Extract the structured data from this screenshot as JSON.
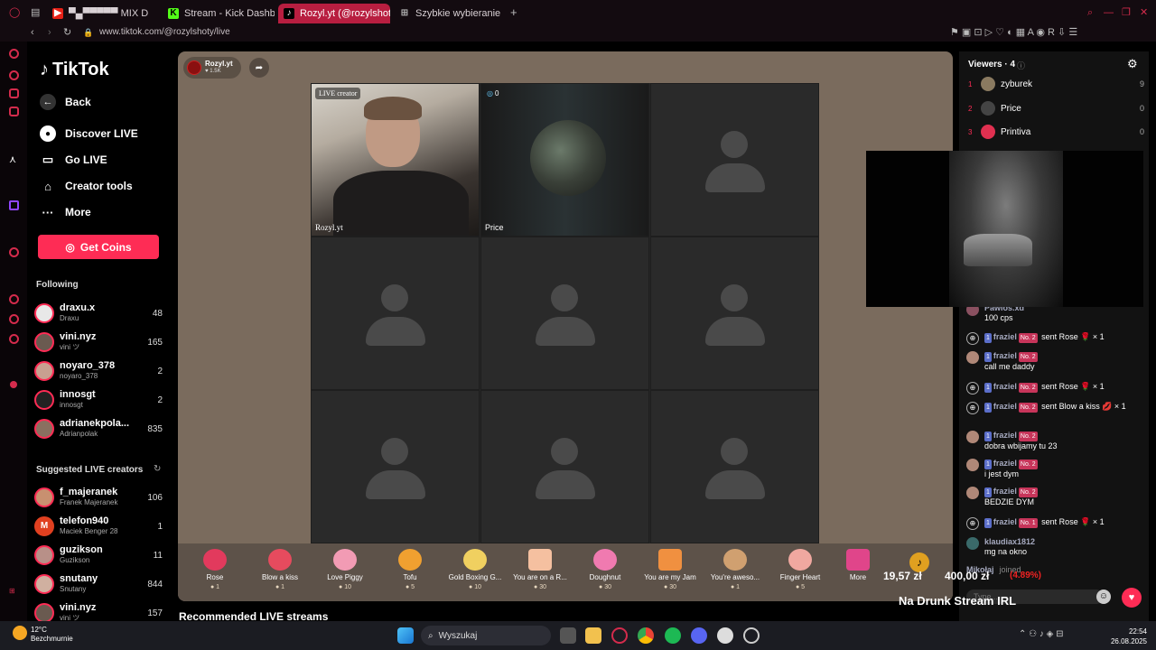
{
  "browser": {
    "tabs": [
      {
        "title": "▀▄▀▀▀▀▀ MIX D",
        "icon": "youtube-icon"
      },
      {
        "title": "Stream - Kick Dashboard",
        "icon": "kick-icon"
      },
      {
        "title": "Rozyl.yt (@rozylshoty",
        "icon": "tiktok-icon"
      },
      {
        "title": "Szybkie wybieranie",
        "icon": "speed-dial-icon"
      }
    ],
    "url": "www.tiktok.com/@rozylshoty/live"
  },
  "tiktok": {
    "logo": "TikTok",
    "nav": {
      "back": "Back",
      "discover": "Discover LIVE",
      "go_live": "Go LIVE",
      "creator_tools": "Creator tools",
      "more": "More"
    },
    "get_coins": "Get Coins",
    "following_title": "Following",
    "following": [
      {
        "name": "draxu.x",
        "sub": "Draxu",
        "count": "48"
      },
      {
        "name": "vini.nyz",
        "sub": "vini ツ",
        "count": "165"
      },
      {
        "name": "noyaro_378",
        "sub": "noyaro_378",
        "count": "2"
      },
      {
        "name": "innosgt",
        "sub": "innosgt",
        "count": "2"
      },
      {
        "name": "adrianekpola...",
        "sub": "Adrianpolak",
        "count": "835"
      }
    ],
    "suggested_title": "Suggested LIVE creators",
    "suggested": [
      {
        "name": "f_majeranek",
        "sub": "Franek Majeranek",
        "count": "106"
      },
      {
        "name": "telefon940",
        "sub": "Maciek Benger 28",
        "count": "1"
      },
      {
        "name": "guzikson",
        "sub": "Guzikson",
        "count": "11"
      },
      {
        "name": "snutany",
        "sub": "Snutany",
        "count": "844"
      },
      {
        "name": "vini.nyz",
        "sub": "vini ツ",
        "count": "157"
      }
    ],
    "recommended": "Recommended LIVE streams"
  },
  "stream": {
    "host_name": "Rozyl.yt",
    "host_likes": "♥ 1.5K",
    "live_creator_tag": "LIVE creator",
    "host_cell_label": "Rozyl.yt",
    "guest_label": "Price",
    "guest_count": "0"
  },
  "gifts": [
    {
      "name": "Rose",
      "price": "1",
      "color": "#e23a5d"
    },
    {
      "name": "Blow a kiss",
      "price": "1",
      "color": "#e64b5e"
    },
    {
      "name": "Love Piggy",
      "price": "10",
      "color": "#f29bb4"
    },
    {
      "name": "Tofu",
      "price": "5",
      "color": "#f0a030"
    },
    {
      "name": "Gold Boxing G...",
      "price": "10",
      "color": "#f0d060"
    },
    {
      "name": "You are on a R...",
      "price": "30",
      "color": "#f5c0a0"
    },
    {
      "name": "Doughnut",
      "price": "30",
      "color": "#f07ab0"
    },
    {
      "name": "You are my Jam",
      "price": "30",
      "color": "#f09040"
    },
    {
      "name": "You're aweso...",
      "price": "1",
      "color": "#d0a070"
    },
    {
      "name": "Finger Heart",
      "price": "5",
      "color": "#f0a8a0"
    },
    {
      "name": "More",
      "price": "",
      "color": "#e0458a"
    }
  ],
  "viewers": {
    "title": "Viewers · 4",
    "list": [
      {
        "rank": "1",
        "name": "zyburek",
        "count": "9",
        "color": "#8a7a60"
      },
      {
        "rank": "2",
        "name": "Price",
        "count": "0",
        "color": "#444"
      },
      {
        "rank": "3",
        "name": "Printiva",
        "count": "0",
        "color": "#e03050"
      }
    ]
  },
  "chat": [
    {
      "user": "Pawlos.xd",
      "msg": "100 cps",
      "type": "comment"
    },
    {
      "user": "fraziel",
      "lvl": "No. 2",
      "msg": "sent Rose 🌹 × 1",
      "type": "gift"
    },
    {
      "user": "fraziel",
      "lvl": "No. 2",
      "msg": "call me daddy",
      "type": "comment"
    },
    {
      "user": "fraziel",
      "lvl": "No. 2",
      "msg": "sent Rose 🌹 × 1",
      "type": "gift"
    },
    {
      "user": "fraziel",
      "lvl": "No. 2",
      "msg": "sent Blow a kiss 💋 × 1",
      "type": "gift"
    },
    {
      "user": "fraziel",
      "lvl": "No. 2",
      "msg": "dobra wbijamy tu 23",
      "type": "comment"
    },
    {
      "user": "fraziel",
      "lvl": "No. 2",
      "msg": "i jest dym",
      "type": "comment"
    },
    {
      "user": "fraziel",
      "lvl": "No. 2",
      "msg": "BEDZIE DYM",
      "type": "comment"
    },
    {
      "user": "fraziel",
      "lvl": "No. 1",
      "msg": "sent Rose 🌹 × 1",
      "type": "gift"
    },
    {
      "user": "klaudiax1812",
      "msg": "mg na okno",
      "type": "comment"
    },
    {
      "user": "Mikołaj",
      "msg": "joined",
      "type": "join"
    }
  ],
  "chat_badge": "1",
  "chat_placeholder": "Type...",
  "donation": {
    "current": "19,57 zł",
    "goal": "400,00 zł",
    "percent": "(4.89%)",
    "title": "Na Drunk Stream IRL"
  },
  "taskbar": {
    "weather_temp": "12°C",
    "weather_desc": "Bezchmurnie",
    "search": "Wyszukaj",
    "time": "22:54",
    "date": "26.08.2025"
  }
}
